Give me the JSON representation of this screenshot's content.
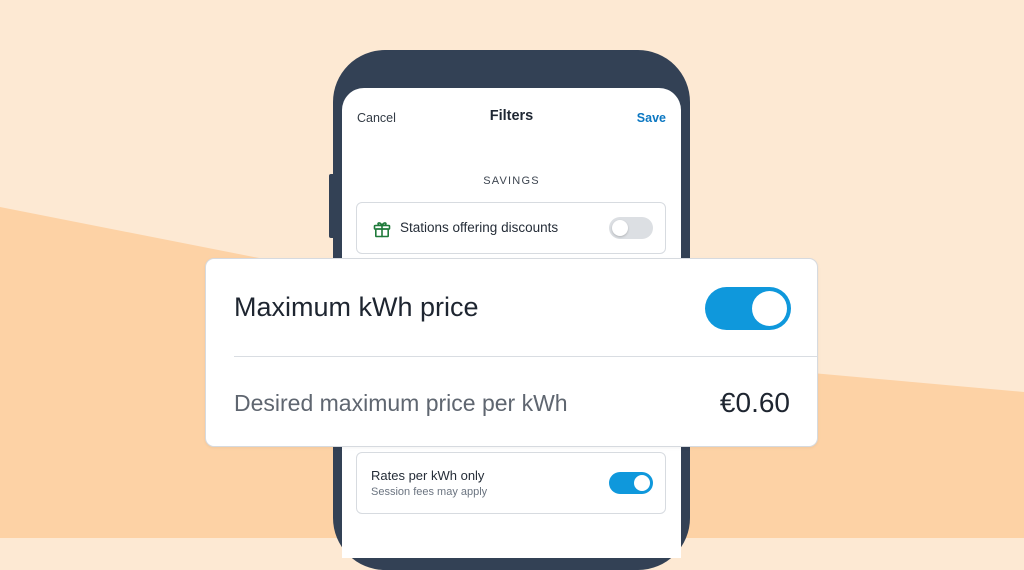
{
  "nav": {
    "cancel_label": "Cancel",
    "title": "Filters",
    "save_label": "Save"
  },
  "savings": {
    "section_label": "SAVINGS",
    "discounts": {
      "label": "Stations offering discounts",
      "icon": "gift-icon",
      "enabled": false
    }
  },
  "max_price": {
    "label": "Maximum kWh price",
    "enabled": true,
    "desired_label": "Desired maximum price per kWh",
    "value": "€0.60"
  },
  "rates": {
    "label": "Rates per kWh only",
    "sublabel": "Session fees may apply",
    "enabled": true
  },
  "colors": {
    "accent_toggle": "#0f98dc",
    "save_link": "#0b77c2",
    "phone_frame": "#334155",
    "background_light": "#fde9d3",
    "background_dark": "#fdd2a5",
    "gift_icon": "#1f7a3a"
  }
}
